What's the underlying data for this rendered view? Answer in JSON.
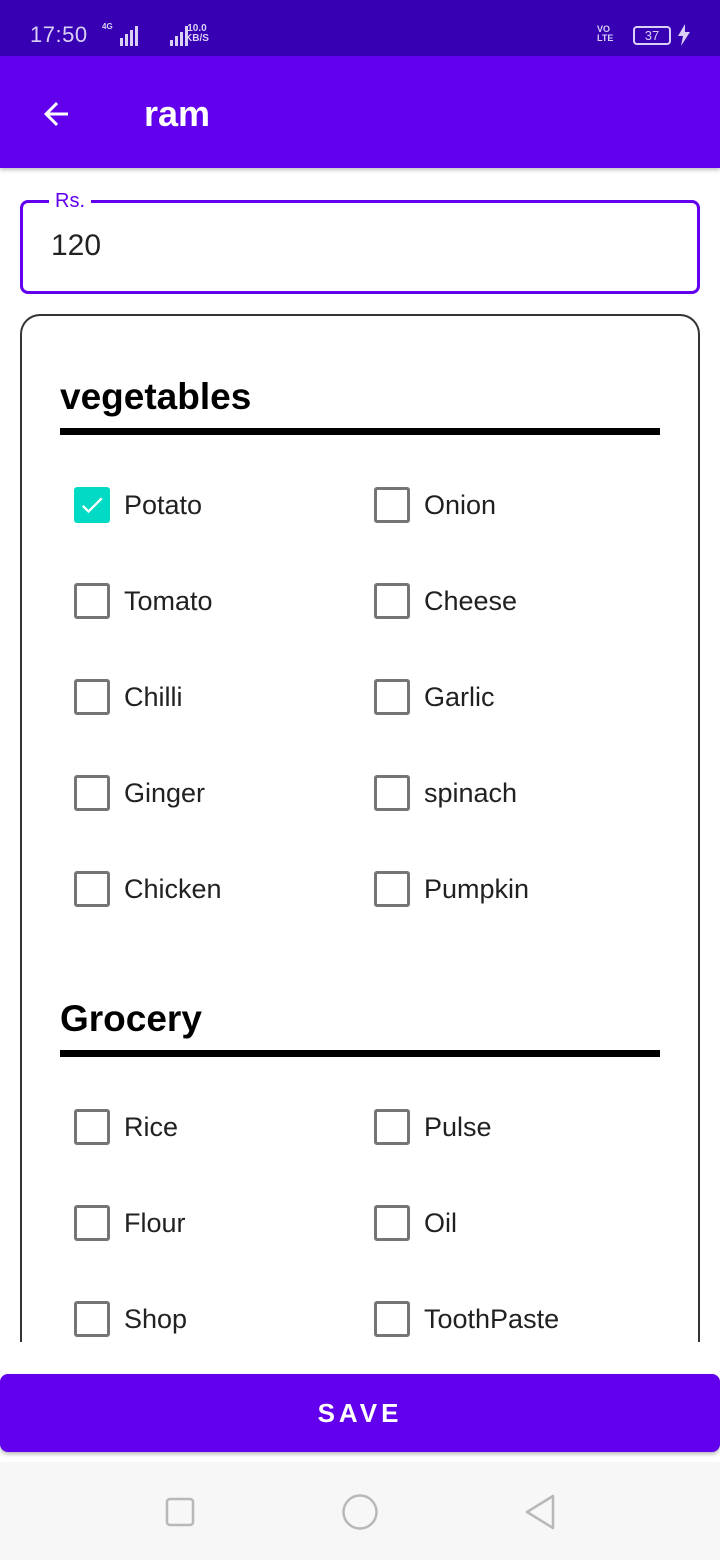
{
  "status_bar": {
    "time": "17:50",
    "network_1": "4G",
    "speed_value": "10.0",
    "speed_unit": "KB/S",
    "volte_top": "VO",
    "volte_bottom": "LTE",
    "battery": "37"
  },
  "app_bar": {
    "title": "ram",
    "back_icon": "arrow-left-icon"
  },
  "amount": {
    "label": "Rs.",
    "value": "120"
  },
  "sections": [
    {
      "title": "vegetables",
      "items": [
        {
          "label": "Potato",
          "checked": true
        },
        {
          "label": "Onion",
          "checked": false
        },
        {
          "label": "Tomato",
          "checked": false
        },
        {
          "label": "Cheese",
          "checked": false
        },
        {
          "label": "Chilli",
          "checked": false
        },
        {
          "label": "Garlic",
          "checked": false
        },
        {
          "label": "Ginger",
          "checked": false
        },
        {
          "label": "spinach",
          "checked": false
        },
        {
          "label": "Chicken",
          "checked": false
        },
        {
          "label": "Pumpkin",
          "checked": false
        }
      ]
    },
    {
      "title": "Grocery",
      "items": [
        {
          "label": "Rice",
          "checked": false
        },
        {
          "label": "Pulse",
          "checked": false
        },
        {
          "label": "Flour",
          "checked": false
        },
        {
          "label": "Oil",
          "checked": false
        },
        {
          "label": "Shop",
          "checked": false
        },
        {
          "label": "ToothPaste",
          "checked": false
        }
      ]
    }
  ],
  "save_button": {
    "label": "SAVE"
  },
  "nav_bar": {
    "icons": [
      "recent-apps-icon",
      "home-icon",
      "back-triangle-icon"
    ]
  },
  "colors": {
    "primary": "#6200ee",
    "primary_dark": "#3700b3",
    "accent": "#03dac5"
  }
}
